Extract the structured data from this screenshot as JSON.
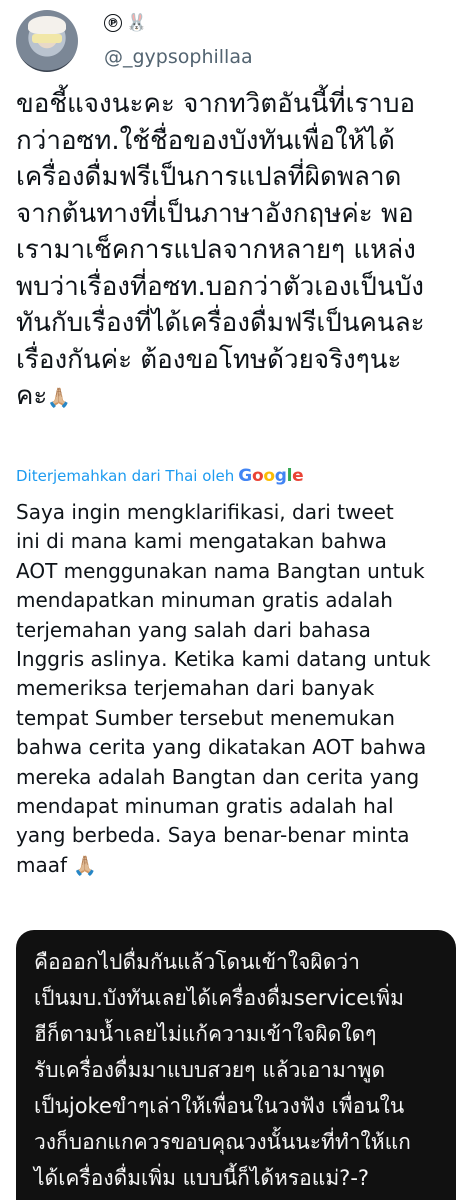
{
  "author": {
    "verified_symbol": "℗",
    "emoji": "🐰",
    "handle": "@_gypsophillaa"
  },
  "tweet_thai_lines": [
    "ขอชี้แจงนะคะ จากทวิตอันนี้ที่เราบอ",
    "กว่าอซท.ใช้ชื่อของบังทันเพื่อให้ได้",
    "เครื่องดื่มฟรีเป็นการแปลที่ผิดพลาด",
    "จากต้นทางที่เป็นภาษาอังกฤษค่ะ พอ",
    "เรามาเช็คการแปลจากหลายๆ แหล่ง",
    "พบว่าเรื่องที่อซท.บอกว่าตัวเองเป็นบัง",
    "ทันกับเรื่องที่ได้เครื่องดื่มฟรีเป็นคนละ",
    "เรื่องกันค่ะ ต้องขอโทษด้วยจริงๆนะ",
    "คะ"
  ],
  "tweet_thai_emoji": "🙏🏼",
  "translation": {
    "label": "Diterjemahkan dari Thai oleh",
    "provider": "Google"
  },
  "tweet_indo_lines": [
    "Saya ingin mengklarifikasi, dari tweet",
    "ini di mana kami mengatakan bahwa",
    "AOT menggunakan nama Bangtan untuk",
    "mendapatkan minuman gratis adalah",
    "terjemahan yang salah dari bahasa",
    "Inggris aslinya. Ketika kami datang untuk",
    "memeriksa terjemahan dari banyak",
    "tempat Sumber tersebut menemukan",
    "bahwa cerita yang dikatakan AOT bahwa",
    "mereka adalah Bangtan dan cerita yang",
    "mendapat minuman gratis adalah hal",
    "yang berbeda. Saya benar-benar minta",
    "maaf"
  ],
  "tweet_indo_emoji": "🙏🏼",
  "quoted_image_lines": [
    "คือออกไปดื่มกันแล้วโดนเข้าใจผิดว่า",
    "เป็นมบ.บังทันเลยได้เครื่องดื่มserviceเพิ่ม",
    "ฮีก็ตามน้ำเลยไม่แก้ความเข้าใจผิดใดๆ",
    "รับเครื่องดื่มมาแบบสวยๆ แล้วเอามาพูด",
    "เป็นjokeขำๆเล่าให้เพื่อนในวงฟัง เพื่อนใน",
    "วงก็บอกแกควรขอบคุณวงนั้นนะที่ทำให้แก",
    "ได้เครื่องดื่มเพิ่ม แบบนี้ก็ได้หรอแม่?-?"
  ],
  "colors": {
    "text": "#0f1419",
    "muted": "#536471",
    "link": "#1d9bf0",
    "card_bg": "#111111"
  }
}
